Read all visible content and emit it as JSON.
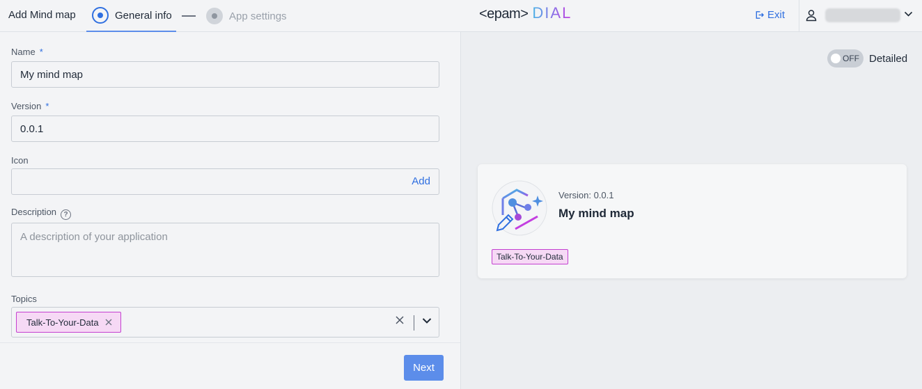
{
  "header": {
    "page_title": "Add Mind map",
    "steps": [
      {
        "label": "General info",
        "state": "active"
      },
      {
        "label": "App settings",
        "state": "inactive"
      }
    ],
    "logo": {
      "epam": "<epam>",
      "dial": "DIAL"
    },
    "exit_label": "Exit",
    "user_name": ""
  },
  "form": {
    "name": {
      "label": "Name",
      "required_mark": "*",
      "value": "My mind map"
    },
    "version": {
      "label": "Version",
      "required_mark": "*",
      "value": "0.0.1"
    },
    "icon": {
      "label": "Icon",
      "add_label": "Add"
    },
    "description": {
      "label": "Description",
      "help_glyph": "?",
      "placeholder": "A description of your application"
    },
    "topics": {
      "label": "Topics",
      "chips": [
        "Talk-To-Your-Data"
      ]
    },
    "next_label": "Next"
  },
  "preview": {
    "toggle": {
      "state_text": "OFF",
      "label": "Detailed"
    },
    "card": {
      "version_text": "Version: 0.0.1",
      "title": "My mind map",
      "topic_chip": "Talk-To-Your-Data"
    }
  },
  "colors": {
    "accent": "#2f6fe0",
    "button": "#5c8dea",
    "chip_bg": "#f6d9f5",
    "chip_border": "#c43fd0"
  },
  "icons": [
    "radio-active-icon",
    "radio-inactive-icon",
    "exit-icon",
    "user-icon",
    "chevron-down-icon",
    "help-icon",
    "close-icon",
    "app-icon"
  ]
}
